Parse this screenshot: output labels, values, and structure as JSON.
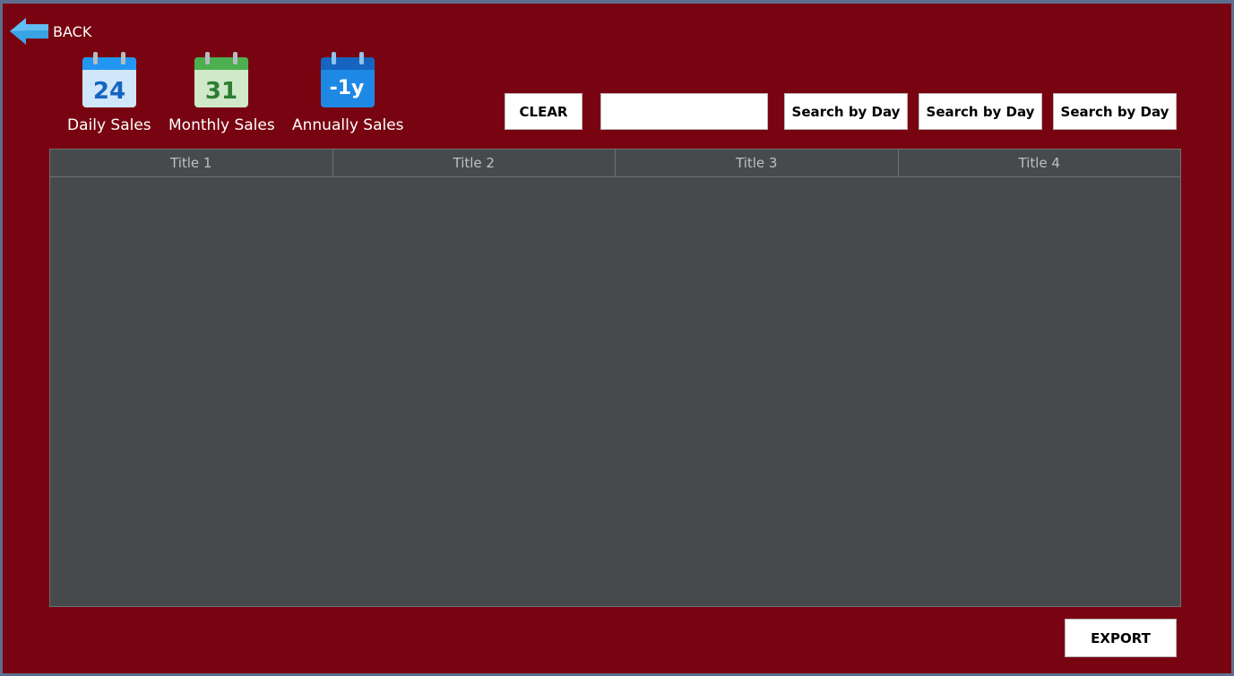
{
  "back": {
    "label": "BACK",
    "icon": "back-arrow-icon"
  },
  "nav": [
    {
      "label": "Daily Sales",
      "icon_text": "24",
      "icon": "daily-calendar-icon",
      "color": "#2196f3"
    },
    {
      "label": "Monthly Sales",
      "icon_text": "31",
      "icon": "monthly-calendar-icon",
      "color": "#4caf50"
    },
    {
      "label": "Annually Sales",
      "icon_text": "-1y",
      "icon": "annual-calendar-icon",
      "color": "#1e88e5"
    }
  ],
  "toolbar": {
    "clear_label": "CLEAR",
    "search_value": "",
    "search_placeholder": "",
    "search_buttons": [
      "Search by Day",
      "Search by Day",
      "Search by Day"
    ]
  },
  "table": {
    "columns": [
      "Title 1",
      "Title 2",
      "Title 3",
      "Title 4"
    ],
    "rows": []
  },
  "footer": {
    "export_label": "EXPORT"
  },
  "colors": {
    "background": "#790411",
    "grid": "#474a4d",
    "border": "#5e6e8e"
  }
}
